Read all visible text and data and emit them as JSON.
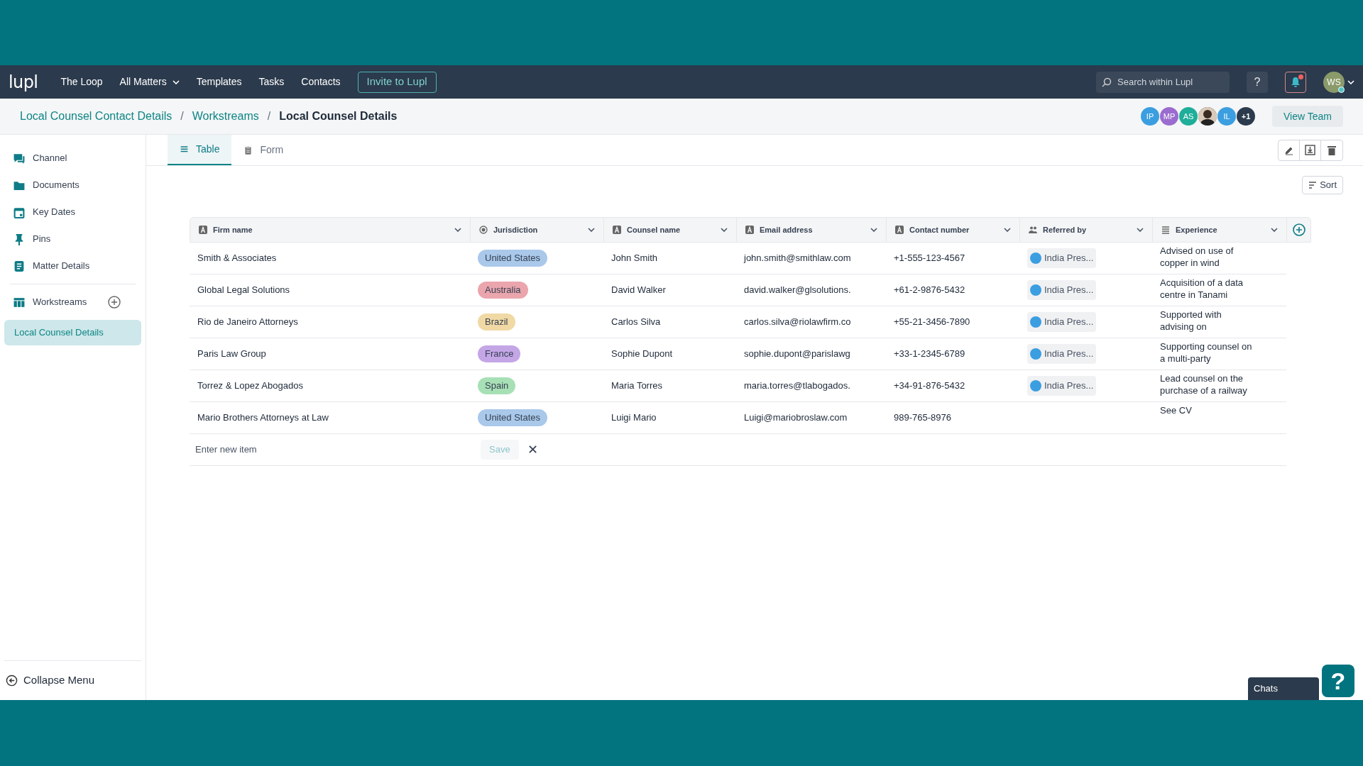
{
  "nav": {
    "logo": "lupl",
    "items": [
      {
        "label": "The Loop",
        "dropdown": false
      },
      {
        "label": "All Matters",
        "dropdown": true
      },
      {
        "label": "Templates",
        "dropdown": false
      },
      {
        "label": "Tasks",
        "dropdown": false
      },
      {
        "label": "Contacts",
        "dropdown": false
      }
    ],
    "invite": "Invite to Lupl",
    "search": {
      "placeholder": "Search within Lupl"
    },
    "help": "?",
    "notifications": true,
    "user": {
      "initials": "WS"
    }
  },
  "breadcrumb": [
    {
      "label": "Local Counsel Contact Details",
      "current": false
    },
    {
      "separator": "/",
      "label": "Workstreams",
      "current": false
    },
    {
      "separator": "/",
      "label": "Local Counsel Details",
      "current": true
    }
  ],
  "team": {
    "members": [
      {
        "kind": "initials",
        "initials": "IP",
        "color": "#3b9ee0"
      },
      {
        "kind": "initials",
        "initials": "MP",
        "color": "#9b6ccf"
      },
      {
        "kind": "initials",
        "initials": "AS",
        "color": "#1fae9a"
      },
      {
        "kind": "picture",
        "color": "#555555"
      },
      {
        "kind": "initials",
        "initials": "IL",
        "color": "#3b9ee0"
      }
    ],
    "more": "+1",
    "button": "View Team"
  },
  "sidebar": {
    "items": [
      {
        "label": "Channel",
        "kind": "chat",
        "selected": false
      },
      {
        "label": "Documents",
        "kind": "folder",
        "selected": false
      },
      {
        "label": "Key Dates",
        "kind": "calendar",
        "selected": false
      },
      {
        "label": "Pins",
        "kind": "pin",
        "selected": false
      },
      {
        "label": "Matter Details",
        "kind": "doc",
        "selected": false
      },
      {
        "label": "Workstreams",
        "kind": "table",
        "selected": false,
        "add": true
      },
      {
        "label": "Local Counsel Details",
        "kind": "sub",
        "selected": true
      }
    ],
    "collapse": "Collapse Menu"
  },
  "tabs": [
    {
      "label": "Table",
      "kind": "list",
      "selected": true
    },
    {
      "label": "Form",
      "kind": "clipboard",
      "selected": false
    }
  ],
  "sort": "Sort",
  "table": {
    "columns": [
      {
        "label": "Firm name",
        "kind": "text"
      },
      {
        "label": "Jurisdiction",
        "kind": "radio"
      },
      {
        "label": "Counsel name",
        "kind": "text"
      },
      {
        "label": "Email address",
        "kind": "text"
      },
      {
        "label": "Contact number",
        "kind": "text"
      },
      {
        "label": "Referred by",
        "kind": "people"
      },
      {
        "label": "Experience",
        "kind": "lines"
      }
    ],
    "rows": [
      {
        "firm": "Smith & Associates",
        "jurisdiction": {
          "label": "United States",
          "color": "#a9c8ea"
        },
        "counsel": "John Smith",
        "email": "john.smith@smithlaw.com",
        "phone": "+1-555-123-4567",
        "referred": "India Pres...",
        "experience": "Advised on use of copper in wind"
      },
      {
        "firm": "Global Legal Solutions",
        "jurisdiction": {
          "label": "Australia",
          "color": "#eaa5ad"
        },
        "counsel": "David Walker",
        "email": "david.walker@glsolutions.",
        "phone": "+61-2-9876-5432",
        "referred": "India Pres...",
        "experience": "Acquisition of a data centre in Tanami"
      },
      {
        "firm": "Rio de Janeiro Attorneys",
        "jurisdiction": {
          "label": "Brazil",
          "color": "#f0d9a4"
        },
        "counsel": "Carlos Silva",
        "email": "carlos.silva@riolawfirm.co",
        "phone": "+55-21-3456-7890",
        "referred": "India Pres...",
        "experience": "Supported with advising on"
      },
      {
        "firm": "Paris Law Group",
        "jurisdiction": {
          "label": "France",
          "color": "#c4a6e6"
        },
        "counsel": "Sophie Dupont",
        "email": "sophie.dupont@parislawg",
        "phone": "+33-1-2345-6789",
        "referred": "India Pres...",
        "experience": "Supporting counsel on a multi-party"
      },
      {
        "firm": "Torrez & Lopez Abogados",
        "jurisdiction": {
          "label": "Spain",
          "color": "#a8e0b6"
        },
        "counsel": "Maria Torres",
        "email": "maria.torres@tlabogados.",
        "phone": "+34-91-876-5432",
        "referred": "India Pres...",
        "experience": "Lead counsel on the purchase of a railway"
      },
      {
        "firm": "Mario Brothers Attorneys at Law",
        "jurisdiction": {
          "label": "United States",
          "color": "#a9c8ea"
        },
        "counsel": "Luigi Mario",
        "email": "Luigi@mariobroslaw.com",
        "phone": "989-765-8976",
        "experience": "See CV"
      }
    ],
    "new_item": {
      "placeholder": "Enter new item",
      "save": "Save",
      "cancel": "✕"
    }
  },
  "chat": {
    "label": "Chats",
    "help": "?"
  }
}
